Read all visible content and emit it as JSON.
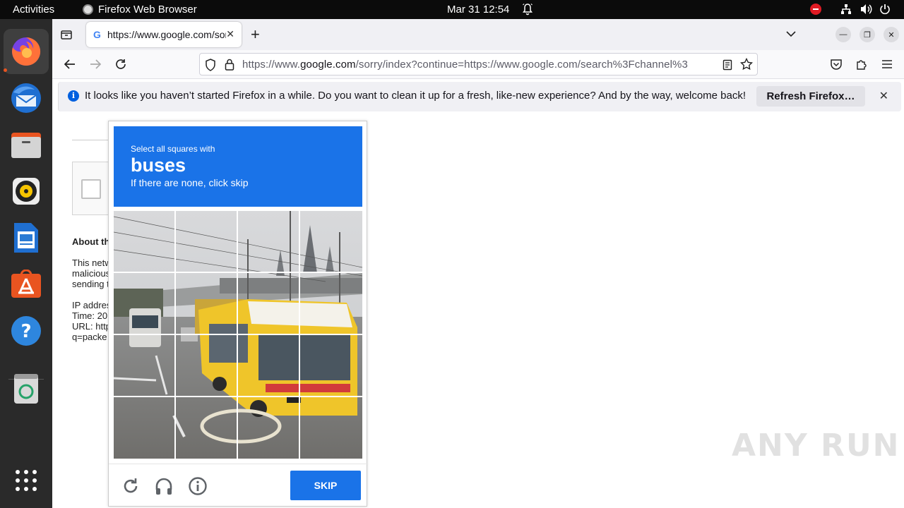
{
  "topbar": {
    "activities": "Activities",
    "app_name": "Firefox Web Browser",
    "datetime": "Mar 31  12:54"
  },
  "dock": {
    "items": [
      "firefox-icon",
      "thunderbird-icon",
      "files-icon",
      "rhythmbox-icon",
      "libreoffice-writer-icon",
      "app-center-icon",
      "help-icon",
      "trash-icon",
      "show-apps-icon"
    ]
  },
  "browser": {
    "tab_title": "https://www.google.com/sorry/index?continue",
    "tab_favicon": "G",
    "url_prefix": "https://www.",
    "url_domain": "google.com",
    "url_rest": "/sorry/index?continue=https://www.google.com/search%3Fchannel%3"
  },
  "notification": {
    "message": "It looks like you haven’t started Firefox in a while. Do you want to clean it up for a fresh, like-new experience? And by the way, welcome back!",
    "button": "Refresh Firefox…"
  },
  "background_page": {
    "about_heading": "About th",
    "lines": [
      "This netw",
      "malicious",
      "sending t",
      "IP addres",
      "Time: 20",
      "URL: http",
      "q=packe"
    ]
  },
  "captcha": {
    "instruction": "Select all squares with",
    "target": "buses",
    "hint": "If there are none, click skip",
    "skip_label": "SKIP"
  },
  "watermark": "ANY RUN",
  "colors": {
    "captcha_blue": "#1a73e8",
    "dock_bg": "#2a2a2a",
    "topbar_bg": "#0b0b0b",
    "ubuntu_orange": "#e95420"
  }
}
